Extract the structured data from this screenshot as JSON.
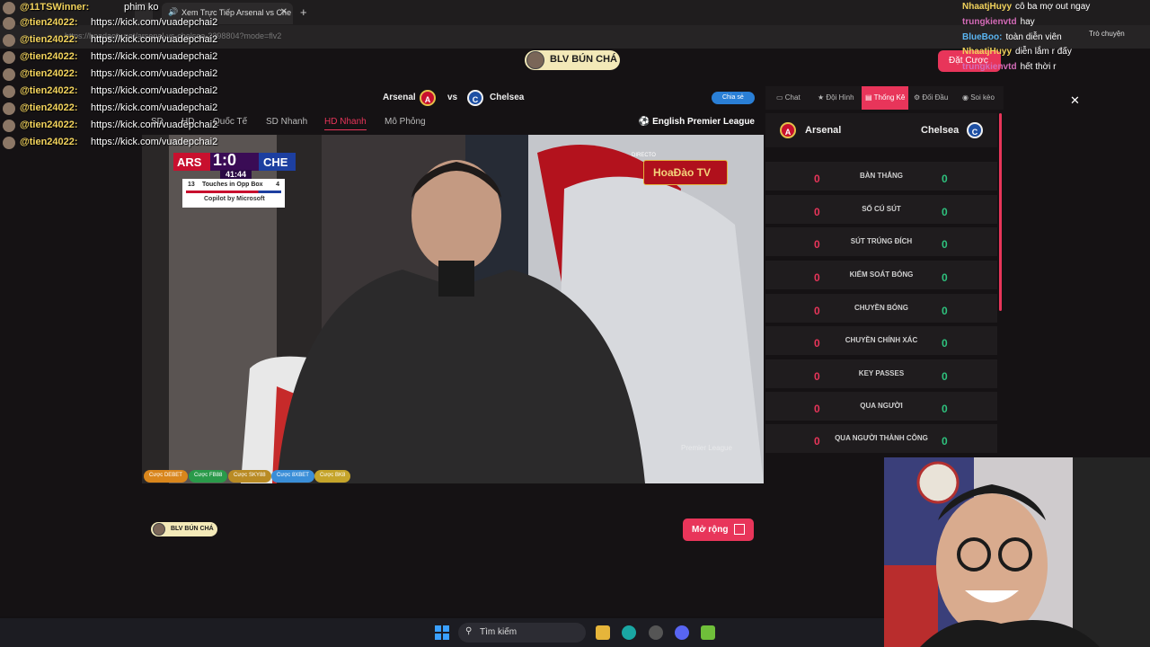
{
  "browser": {
    "tab_title": "Xem Trực Tiếp Arsenal vs Che",
    "url": "https://hoadaotv.net/arsenal-vs-chelsea-2398804?mode=flv2"
  },
  "left_chat": [
    {
      "user": "@11TSWinner:",
      "msg": "phim ko"
    },
    {
      "user": "@tien24022:",
      "msg": "https://kick.com/vuadepchai2"
    },
    {
      "user": "@tien24022:",
      "msg": "https://kick.com/vuadepchai2"
    },
    {
      "user": "@tien24022:",
      "msg": "https://kick.com/vuadepchai2"
    },
    {
      "user": "@tien24022:",
      "msg": "https://kick.com/vuadepchai2"
    },
    {
      "user": "@tien24022:",
      "msg": "https://kick.com/vuadepchai2"
    },
    {
      "user": "@tien24022:",
      "msg": "https://kick.com/vuadepchai2"
    },
    {
      "user": "@tien24022:",
      "msg": "https://kick.com/vuadepchai2"
    },
    {
      "user": "@tien24022:",
      "msg": "https://kick.com/vuadepchai2"
    },
    {
      "user": "@tien24022:",
      "msg": "https://kick.com/vuadepchai2"
    }
  ],
  "right_chat": [
    {
      "user": "NhaatjHuyy",
      "msg": "cô ba mợ out ngay",
      "color": "#f2d35c"
    },
    {
      "user": "trungkienvtd",
      "msg": "hay",
      "color": "#d46bb8"
    },
    {
      "user": "BlueBoo:",
      "msg": "toàn diễn viên",
      "color": "#5ab4f0"
    },
    {
      "user": "NhaatjHuyy",
      "msg": "diễn lắm r đấy",
      "color": "#f2d35c"
    },
    {
      "user": "trungkienvtd",
      "msg": "hết thời r",
      "color": "#d46bb8"
    }
  ],
  "tro_chuyen": "Trò chuyện",
  "blv_top": "BLV BÚN CHÁ",
  "dat_cuoc": "Đặt Cược",
  "match": {
    "home": "Arsenal",
    "vs": "vs",
    "away": "Chelsea",
    "share": "Chia sẻ"
  },
  "source_tabs": [
    "SD",
    "HD",
    "Quốc Tế",
    "SD Nhanh",
    "HD Nhanh",
    "Mô Phỏng"
  ],
  "league": "English Premier League",
  "scorebug": {
    "home": "ARS",
    "away": "CHE",
    "score": "1:0",
    "time": "41:44",
    "stat_home": "13",
    "stat_label": "Touches in Opp Box",
    "stat_away": "4",
    "sponsor": "Copilot by Microsoft"
  },
  "directo": "DIRECTO",
  "broadcaster_logo": "HoaĐào TV",
  "watermark": "Premier League",
  "bet_pills": [
    {
      "label": "Cược DEBET",
      "color": "#d9861c"
    },
    {
      "label": "Cược FB88",
      "color": "#2a9a4a"
    },
    {
      "label": "Cược SKY88",
      "color": "#b98b24"
    },
    {
      "label": "Cược 8XBET",
      "color": "#3a8ed8"
    },
    {
      "label": "Cược BK8",
      "color": "#c5a42a"
    }
  ],
  "panel_tabs": [
    "Chat",
    "Đội Hình",
    "Thống Kê",
    "Đối Đầu",
    "Soi kèo"
  ],
  "stats": [
    {
      "name": "BÀN THẮNG",
      "home": "0",
      "away": "0"
    },
    {
      "name": "SỐ CÚ SÚT",
      "home": "0",
      "away": "0"
    },
    {
      "name": "SÚT TRÚNG ĐÍCH",
      "home": "0",
      "away": "0"
    },
    {
      "name": "KIỂM SOÁT BÓNG",
      "home": "0",
      "away": "0"
    },
    {
      "name": "CHUYỀN BÓNG",
      "home": "0",
      "away": "0"
    },
    {
      "name": "CHUYỀN CHÍNH XÁC",
      "home": "0",
      "away": "0"
    },
    {
      "name": "KEY PASSES",
      "home": "0",
      "away": "0"
    },
    {
      "name": "QUA NGƯỜI",
      "home": "0",
      "away": "0"
    },
    {
      "name": "QUA NGƯỜI THÀNH CÔNG",
      "home": "0",
      "away": "0"
    }
  ],
  "blv_bottom": "BLV BÚN CHÁ",
  "mo_rong": "Mở rộng",
  "taskbar": {
    "search": "Tìm kiếm"
  },
  "accent": "#e8355a"
}
